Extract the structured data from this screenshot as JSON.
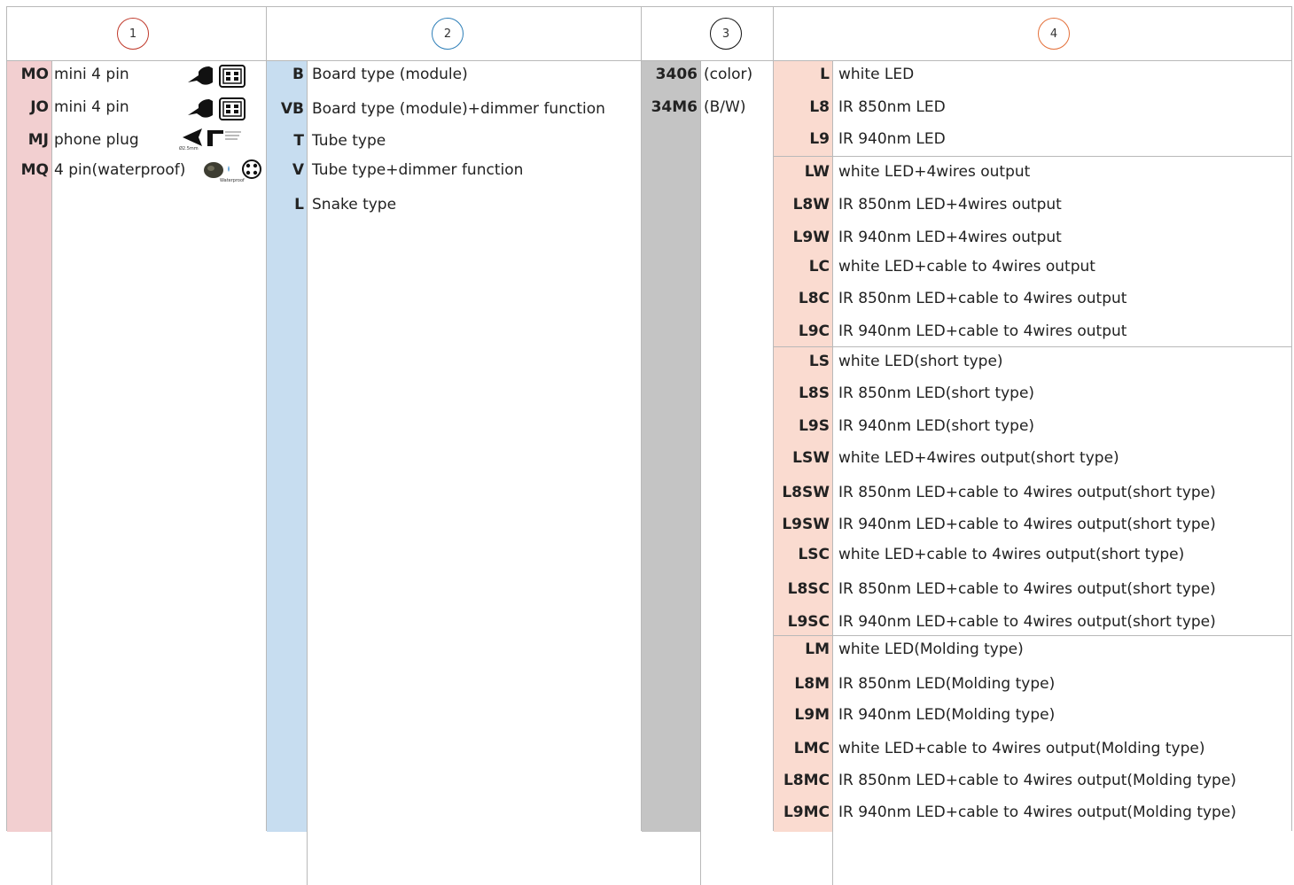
{
  "headers": [
    {
      "number": "1",
      "color": "#c0392b"
    },
    {
      "number": "2",
      "color": "#2e7fb8"
    },
    {
      "number": "3",
      "color": "#111111"
    },
    {
      "number": "4",
      "color": "#e4703a"
    }
  ],
  "colors": {
    "col1_band": "#f2cfd0",
    "col2_band": "#c7ddf0",
    "col3_band": "#c4c4c4",
    "col4_band": "#fadbd0",
    "grid": "#b9b9b9"
  },
  "connectors": [
    {
      "code": "MO",
      "desc": "mini 4 pin",
      "icon": "mini-plug-with-socket-icon"
    },
    {
      "code": "JO",
      "desc": "mini 4 pin",
      "icon": "mini-plug-with-socket-icon"
    },
    {
      "code": "MJ",
      "desc": "phone plug",
      "icon": "phone-plug-icon",
      "icon_caption": "Ø2.5mm"
    },
    {
      "code": "MQ",
      "desc": "4 pin(waterproof)",
      "icon": "waterproof-connector-icon",
      "icon_caption": "Waterproof"
    }
  ],
  "types": [
    {
      "code": "B",
      "desc": "Board type (module)"
    },
    {
      "code": "VB",
      "desc": "Board type (module)+dimmer function"
    },
    {
      "code": "T",
      "desc": "Tube type"
    },
    {
      "code": "V",
      "desc": "Tube type+dimmer function"
    },
    {
      "code": "L",
      "desc": "Snake type"
    }
  ],
  "sensors": [
    {
      "code": "3406",
      "desc": "(color)"
    },
    {
      "code": "34M6",
      "desc": "(B/W)"
    }
  ],
  "leds": [
    {
      "code": "L",
      "desc": "white LED"
    },
    {
      "code": "L8",
      "desc": "IR 850nm LED"
    },
    {
      "code": "L9",
      "desc": "IR 940nm LED"
    },
    {
      "code": "LW",
      "desc": "white LED+4wires output"
    },
    {
      "code": "L8W",
      "desc": "IR 850nm LED+4wires output"
    },
    {
      "code": "L9W",
      "desc": "IR 940nm LED+4wires output"
    },
    {
      "code": "LC",
      "desc": "white LED+cable to 4wires output"
    },
    {
      "code": "L8C",
      "desc": "IR 850nm LED+cable to 4wires output"
    },
    {
      "code": "L9C",
      "desc": "IR 940nm LED+cable to 4wires output"
    },
    {
      "code": "LS",
      "desc": "white LED(short type)"
    },
    {
      "code": "L8S",
      "desc": "IR 850nm LED(short type)"
    },
    {
      "code": "L9S",
      "desc": "IR 940nm LED(short type)"
    },
    {
      "code": "LSW",
      "desc": "white LED+4wires output(short type)"
    },
    {
      "code": "L8SW",
      "desc": "IR 850nm LED+cable to 4wires output(short type)"
    },
    {
      "code": "L9SW",
      "desc": "IR 940nm LED+cable to 4wires output(short type)"
    },
    {
      "code": "LSC",
      "desc": "white LED+cable to 4wires output(short type)"
    },
    {
      "code": "L8SC",
      "desc": "IR 850nm LED+cable to 4wires output(short type)"
    },
    {
      "code": "L9SC",
      "desc": "IR 940nm LED+cable to 4wires output(short type)"
    },
    {
      "code": "LM",
      "desc": "white LED(Molding type)"
    },
    {
      "code": "L8M",
      "desc": "IR 850nm LED(Molding type)"
    },
    {
      "code": "L9M",
      "desc": "IR 940nm LED(Molding type)"
    },
    {
      "code": "LMC",
      "desc": "white LED+cable to 4wires output(Molding type)"
    },
    {
      "code": "L8MC",
      "desc": "IR 850nm LED+cable to 4wires output(Molding type)"
    },
    {
      "code": "L9MC",
      "desc": "IR 940nm LED+cable to 4wires output(Molding type)"
    }
  ]
}
